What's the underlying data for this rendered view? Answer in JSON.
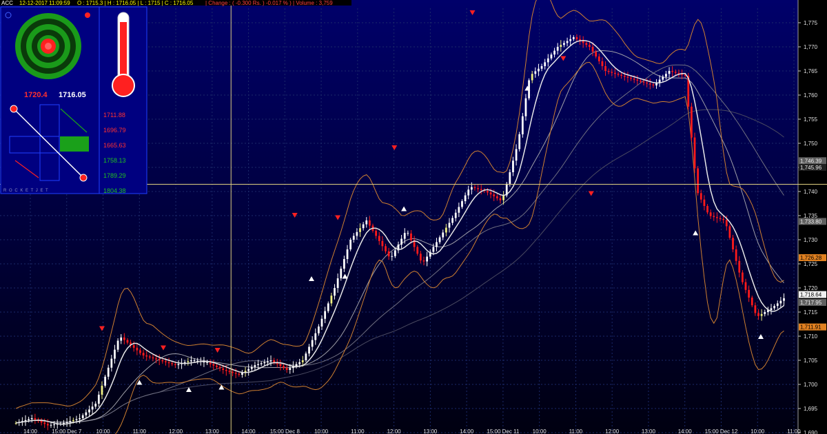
{
  "header": {
    "symbol": "ACC",
    "datetime": "12-12-2017 11:09:59",
    "ohlc": "O : 1715.3 | H : 1716.05 | L : 1715 | C : 1716.05",
    "change": "| Change : ( -0.300 Rs. ) -0.017 % ) | Volume : 3,759"
  },
  "widget": {
    "left_value": "1720.4",
    "right_value": "1716.05",
    "levels": [
      "1711.88",
      "1696.79",
      "1665.63",
      "1758.13",
      "1789.29",
      "1804.38"
    ],
    "level_colors": [
      "#ff3030",
      "#ff3030",
      "#ff3030",
      "#20c020",
      "#20c020",
      "#20c020"
    ],
    "brand": "R O C K E T   J E T"
  },
  "chart_data": {
    "type": "candlestick",
    "y_axis": {
      "range": [
        1690,
        1778
      ],
      "ticks": [
        "1,775",
        "1,770",
        "1,765",
        "1,760",
        "1,755",
        "1,750",
        "1,745",
        "1,740",
        "1,735",
        "1,730",
        "1,725",
        "1,720",
        "1,715",
        "1,710",
        "1,705",
        "1,700",
        "1,695",
        "1,690"
      ]
    },
    "x_axis": {
      "ticks": [
        "14:00",
        "15:00 Dec 7",
        "10:00",
        "11:00",
        "12:00",
        "13:00",
        "14:00",
        "15:00 Dec 8",
        "10:00",
        "11:00",
        "12:00",
        "13:00",
        "14:00",
        "15:00 Dec 11",
        "10:00",
        "11:00",
        "12:00",
        "13:00",
        "14:00",
        "15:00 Dec 12",
        "10:00",
        "11:00"
      ]
    },
    "price_labels": [
      {
        "text": "1,746.39",
        "value": 1746.39,
        "color": "#606060"
      },
      {
        "text": "1,745.96",
        "value": 1745.0,
        "color": "#202020"
      },
      {
        "text": "1,733.80",
        "value": 1733.8,
        "color": "#606060"
      },
      {
        "text": "1,726.28",
        "value": 1726.28,
        "color": "#e08020"
      },
      {
        "text": "1,718.64",
        "value": 1718.64,
        "color": "#f0f0f0"
      },
      {
        "text": "1,717.95",
        "value": 1717.0,
        "color": "#606060"
      },
      {
        "text": "1,711.91",
        "value": 1711.91,
        "color": "#e08020"
      }
    ],
    "crosshair": {
      "price": 1741.5,
      "time_index": 0.29
    },
    "price_path": [
      [
        0,
        1691
      ],
      [
        0.02,
        1692
      ],
      [
        0.04,
        1693
      ],
      [
        0.06,
        1691.5
      ],
      [
        0.08,
        1692
      ],
      [
        0.1,
        1693
      ],
      [
        0.12,
        1696
      ],
      [
        0.135,
        1703
      ],
      [
        0.15,
        1710
      ],
      [
        0.165,
        1708
      ],
      [
        0.18,
        1706
      ],
      [
        0.2,
        1705
      ],
      [
        0.22,
        1704
      ],
      [
        0.24,
        1705
      ],
      [
        0.26,
        1704.5
      ],
      [
        0.28,
        1703
      ],
      [
        0.3,
        1702
      ],
      [
        0.32,
        1704
      ],
      [
        0.34,
        1705
      ],
      [
        0.36,
        1703
      ],
      [
        0.38,
        1705
      ],
      [
        0.4,
        1712
      ],
      [
        0.42,
        1720
      ],
      [
        0.44,
        1730
      ],
      [
        0.46,
        1734
      ],
      [
        0.475,
        1730
      ],
      [
        0.49,
        1726
      ],
      [
        0.51,
        1732
      ],
      [
        0.53,
        1725
      ],
      [
        0.55,
        1730
      ],
      [
        0.57,
        1735
      ],
      [
        0.59,
        1741
      ],
      [
        0.61,
        1740
      ],
      [
        0.63,
        1738
      ],
      [
        0.65,
        1750
      ],
      [
        0.665,
        1764
      ],
      [
        0.68,
        1766
      ],
      [
        0.7,
        1770
      ],
      [
        0.72,
        1772
      ],
      [
        0.74,
        1770
      ],
      [
        0.76,
        1765
      ],
      [
        0.78,
        1764
      ],
      [
        0.8,
        1763
      ],
      [
        0.82,
        1762
      ],
      [
        0.84,
        1765
      ],
      [
        0.86,
        1764
      ],
      [
        0.875,
        1740
      ],
      [
        0.89,
        1735
      ],
      [
        0.91,
        1734
      ],
      [
        0.93,
        1722
      ],
      [
        0.95,
        1714
      ],
      [
        0.97,
        1716
      ],
      [
        0.985,
        1718
      ]
    ],
    "markers_up": [
      [
        0.175,
        1700.5
      ],
      [
        0.237,
        1699
      ],
      [
        0.278,
        1699.5
      ],
      [
        0.391,
        1722
      ],
      [
        0.433,
        1722.5
      ],
      [
        0.507,
        1736.5
      ],
      [
        0.662,
        1761.5
      ],
      [
        0.873,
        1731.5
      ],
      [
        0.955,
        1710
      ]
    ],
    "markers_down": [
      [
        0.128,
        1711.5
      ],
      [
        0.205,
        1707.5
      ],
      [
        0.273,
        1707
      ],
      [
        0.37,
        1735
      ],
      [
        0.424,
        1734.5
      ],
      [
        0.495,
        1749
      ],
      [
        0.593,
        1777
      ],
      [
        0.707,
        1767.5
      ],
      [
        0.742,
        1739.5
      ]
    ]
  }
}
